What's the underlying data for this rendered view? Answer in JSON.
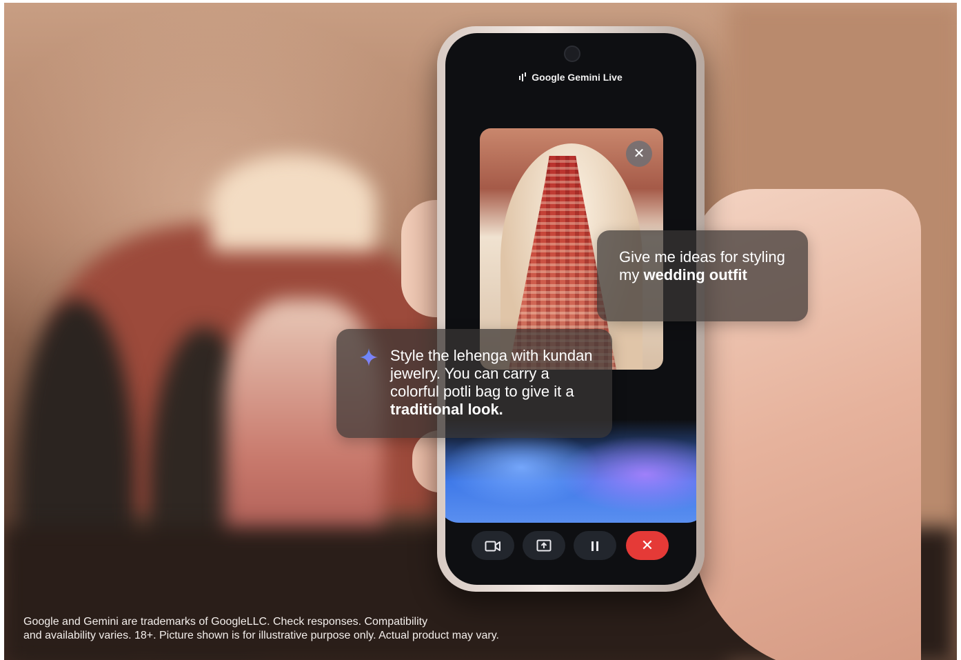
{
  "app": {
    "title": "Google Gemini Live"
  },
  "preview": {
    "close_icon": "close-icon",
    "close_label": "✕"
  },
  "prompts": {
    "user_part1": "Give me ideas for styling my ",
    "user_bold1": "wedding",
    "user_part2": " ",
    "user_bold2": "outfit",
    "ai_part1": "Style the lehenga with kundan jewelry. You can carry a colorful potli bag to give it a ",
    "ai_bold": "traditional look."
  },
  "controls": {
    "video_icon": "video-camera-icon",
    "share_icon": "screen-share-icon",
    "pause_icon": "pause-icon",
    "end_icon": "close-icon",
    "end_label": "✕"
  },
  "colors": {
    "end_call": "#e53a37",
    "gemini_spark": "#6aa1ff",
    "screen_bg": "#0e0f12"
  },
  "disclaimer": {
    "line1": "Google and Gemini are trademarks of GoogleLLC. Check responses. Compatibility",
    "line2": "and availability varies. 18+. Picture shown is for illustrative purpose only. Actual product may vary."
  }
}
